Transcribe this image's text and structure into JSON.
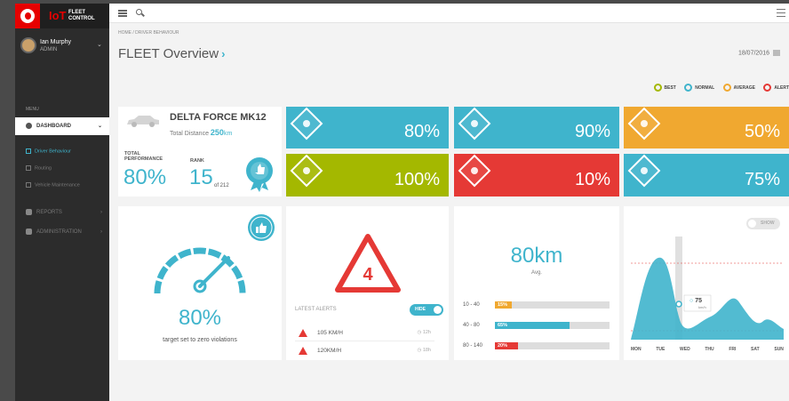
{
  "app": {
    "brand_iot": "IoT",
    "brand_name": "FLEET CONTROL"
  },
  "user": {
    "name": "Ian Murphy",
    "role": "ADMIN"
  },
  "sidebar": {
    "menu_heading": "MENU",
    "items": [
      {
        "label": "DASHBOARD",
        "active": true
      },
      {
        "label": "REPORTS",
        "active": false
      },
      {
        "label": "ADMINISTRATION",
        "active": false
      }
    ],
    "subitems": [
      {
        "label": "Driver Behaviour",
        "active": true
      },
      {
        "label": "Routing",
        "active": false
      },
      {
        "label": "Vehicle Maintenance",
        "active": false
      }
    ]
  },
  "breadcrumb": "HOME / DRIVER BEHAVIOUR",
  "page_title": "FLEET Overview",
  "date": "18/07/2016",
  "legend": [
    {
      "label": "BEST",
      "color": "#a4b800"
    },
    {
      "label": "NORMAL",
      "color": "#3fb4cc"
    },
    {
      "label": "AVERAGE",
      "color": "#f0a830"
    },
    {
      "label": "ALERT",
      "color": "#e53935"
    }
  ],
  "vehicle": {
    "name": "DELTA FORCE MK12",
    "distance_label": "Total Distance",
    "distance_value": "250",
    "distance_unit": "km",
    "perf_label": "TOTAL PERFORMANCE",
    "perf_value": "80%",
    "rank_label": "RANK",
    "rank_value": "15",
    "rank_of": "of 212"
  },
  "tiles": [
    {
      "value": "80%",
      "color": "#3fb4cc",
      "icon": "speedometer-icon"
    },
    {
      "value": "90%",
      "color": "#3fb4cc",
      "icon": "car-crash-icon"
    },
    {
      "value": "50%",
      "color": "#f0a830",
      "icon": "fuel-icon"
    },
    {
      "value": "100%",
      "color": "#a4b800",
      "icon": "brake-icon"
    },
    {
      "value": "10%",
      "color": "#e53935",
      "icon": "phone-driving-icon"
    },
    {
      "value": "75%",
      "color": "#3fb4cc",
      "icon": "tachometer-icon"
    }
  ],
  "gauge": {
    "value": "80%",
    "level": 0.8,
    "caption": "target set to zero violations"
  },
  "alerts": {
    "count": "4",
    "heading": "LATEST ALERTS",
    "toggle_label": "HIDE",
    "rows": [
      {
        "speed": "105 KM/H",
        "time": "12h"
      },
      {
        "speed": "120KM/H",
        "time": "18h"
      }
    ]
  },
  "distance": {
    "value": "80km",
    "label": "Avg.",
    "bars": [
      {
        "range": "10 - 40",
        "pct": "15%",
        "value": 0.15,
        "color": "#f0a830"
      },
      {
        "range": "40 - 80",
        "pct": "65%",
        "value": 0.65,
        "color": "#3fb4cc"
      },
      {
        "range": "80 - 140",
        "pct": "20%",
        "value": 0.2,
        "color": "#e53935"
      }
    ]
  },
  "weekly": {
    "toggle_label": "SHOW",
    "days": [
      "MON",
      "TUE",
      "WED",
      "THU",
      "FRI",
      "SAT",
      "SUN"
    ],
    "marker_value": "75",
    "marker_unit": "km/h"
  }
}
